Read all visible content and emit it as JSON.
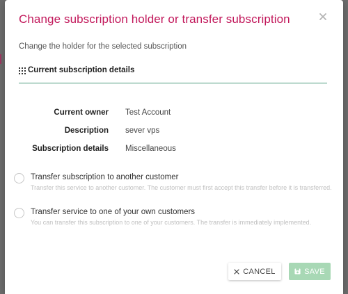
{
  "dialog": {
    "title": "Change subscription holder or transfer subscription",
    "subtitle": "Change the holder for the selected subscription",
    "close_icon": "close-icon"
  },
  "section": {
    "icon": "grip-icon",
    "title": "Current subscription details"
  },
  "details": [
    {
      "label": "Current owner",
      "value": "Test Account"
    },
    {
      "label": "Description",
      "value": "sever vps"
    },
    {
      "label": "Subscription details",
      "value": "Miscellaneous"
    }
  ],
  "options": [
    {
      "label": "Transfer subscription to another customer",
      "description": "Transfer this service to another customer. The customer must first accept this transfer before it is transferred."
    },
    {
      "label": "Transfer service to one of your own customers",
      "description": "You can transfer this subscription to one of your customers. The transfer is immediately implemented."
    }
  ],
  "buttons": {
    "cancel_label": "CANCEL",
    "cancel_icon": "close-icon",
    "save_label": "SAVE",
    "save_icon": "save-icon"
  },
  "colors": {
    "title": "#c2185b",
    "divider": "#4a9a7a",
    "save_bg": "#a8d8b5"
  }
}
